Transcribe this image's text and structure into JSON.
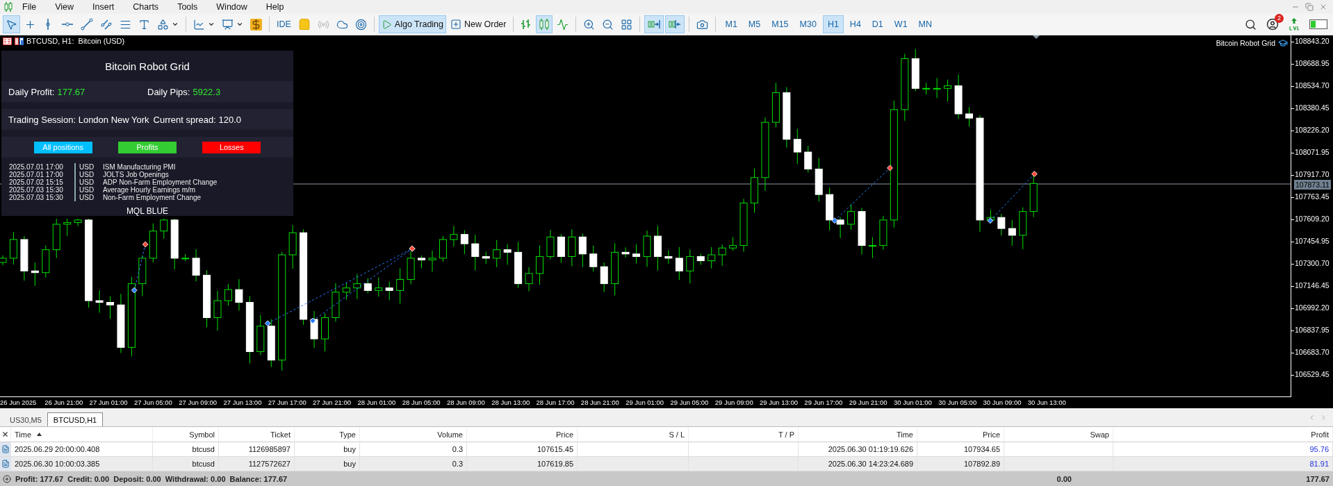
{
  "menu": [
    "File",
    "View",
    "Insert",
    "Charts",
    "Tools",
    "Window",
    "Help"
  ],
  "toolbar": [
    {
      "kind": "cursor",
      "selected": true
    },
    {
      "kind": "crosshair",
      "selected": false
    },
    {
      "kind": "vline",
      "selected": false
    },
    {
      "kind": "hline",
      "selected": false
    },
    {
      "kind": "trendline",
      "selected": false
    },
    {
      "kind": "channel",
      "selected": false
    },
    {
      "kind": "fibo",
      "selected": false
    },
    {
      "kind": "text",
      "selected": false
    },
    {
      "kind": "shapes",
      "selected": false
    },
    {
      "kind": "indicators",
      "selected": false
    },
    {
      "kind": "templates",
      "selected": false
    },
    {
      "kind": "dollar",
      "selected": false
    },
    {
      "kind": "ide",
      "label": "IDE",
      "selected": false
    },
    {
      "kind": "market",
      "selected": false
    },
    {
      "kind": "signals",
      "selected": false
    },
    {
      "kind": "cloud",
      "selected": false
    },
    {
      "kind": "vps",
      "selected": false
    },
    {
      "kind": "algo",
      "label": "Algo Trading",
      "selected": true
    },
    {
      "kind": "order",
      "label": "New Order",
      "selected": false
    },
    {
      "kind": "bars",
      "selected": false
    },
    {
      "kind": "candles",
      "selected": true
    },
    {
      "kind": "line",
      "selected": false
    },
    {
      "kind": "zoomin",
      "selected": false
    },
    {
      "kind": "zoomout",
      "selected": false
    },
    {
      "kind": "tile",
      "selected": false
    },
    {
      "kind": "autoscroll",
      "selected": true
    },
    {
      "kind": "shift",
      "selected": true
    },
    {
      "kind": "screenshot",
      "selected": false
    }
  ],
  "timeframes": [
    {
      "label": "M1",
      "selected": false
    },
    {
      "label": "M5",
      "selected": false
    },
    {
      "label": "M15",
      "selected": false
    },
    {
      "label": "M30",
      "selected": false
    },
    {
      "label": "H1",
      "selected": true
    },
    {
      "label": "H4",
      "selected": false
    },
    {
      "label": "D1",
      "selected": false
    },
    {
      "label": "W1",
      "selected": false
    },
    {
      "label": "MN",
      "selected": false
    }
  ],
  "notifications": {
    "count": "2"
  },
  "chart": {
    "title": "BTCUSD, H1:  Bitcoin (USD)",
    "indicator": "Bitcoin Robot Grid",
    "current_price": "107873.11",
    "price_ticks": [
      "108843.20",
      "108688.95",
      "108534.70",
      "108380.45",
      "108226.20",
      "108071.95",
      "107917.70",
      "107763.45",
      "107609.20",
      "107454.95",
      "107300.70",
      "107146.45",
      "106992.20",
      "106837.95",
      "106683.70",
      "106529.45"
    ],
    "time_ticks": [
      "26 Jun 2025",
      "26 Jun 21:00",
      "27 Jun 01:00",
      "27 Jun 05:00",
      "27 Jun 09:00",
      "27 Jun 13:00",
      "27 Jun 17:00",
      "27 Jun 21:00",
      "28 Jun 01:00",
      "28 Jun 05:00",
      "28 Jun 09:00",
      "28 Jun 13:00",
      "28 Jun 17:00",
      "28 Jun 21:00",
      "29 Jun 01:00",
      "29 Jun 05:00",
      "29 Jun 09:00",
      "29 Jun 13:00",
      "29 Jun 17:00",
      "29 Jun 21:00",
      "30 Jun 01:00",
      "30 Jun 05:00",
      "30 Jun 09:00",
      "30 Jun 13:00"
    ],
    "panel": {
      "title": "Bitcoin Robot Grid",
      "daily_profit_label": "Daily Profit:",
      "daily_profit": "177.67",
      "daily_pips_label": "Daily Pips:",
      "daily_pips": "5922.3",
      "session": "Trading Session: London New York",
      "spread": "Current spread: 120.0",
      "buttons": [
        {
          "label": "All positions",
          "color": "#00bfff"
        },
        {
          "label": "Profits",
          "color": "#33cc33"
        },
        {
          "label": "Losses",
          "color": "#ff0000"
        }
      ],
      "news": [
        {
          "time": "2025.07.01 17:00",
          "currency": "USD",
          "event": "ISM Manufacturing PMI"
        },
        {
          "time": "2025.07.01 17:00",
          "currency": "USD",
          "event": "JOLTS Job Openings"
        },
        {
          "time": "2025.07.02 15:15",
          "currency": "USD",
          "event": "ADP Non-Farm Employment Change"
        },
        {
          "time": "2025.07.03 15:30",
          "currency": "USD",
          "event": "Average Hourly Earnings m/m"
        },
        {
          "time": "2025.07.03 15:30",
          "currency": "USD",
          "event": "Non-Farm Employment Change"
        }
      ],
      "footer": "MQL BLUE"
    }
  },
  "tabs": [
    {
      "label": "US30,M5",
      "selected": false
    },
    {
      "label": "BTCUSD,H1",
      "selected": true
    }
  ],
  "positions": {
    "columns": [
      {
        "label": "Time",
        "sorted": true
      },
      {
        "label": "Symbol",
        "sorted": false
      },
      {
        "label": "Ticket",
        "sorted": false
      },
      {
        "label": "Type",
        "sorted": false
      },
      {
        "label": "Volume",
        "sorted": false
      },
      {
        "label": "Price",
        "sorted": false
      },
      {
        "label": "S / L",
        "sorted": false
      },
      {
        "label": "T / P",
        "sorted": false
      },
      {
        "label": "Time",
        "sorted": false
      },
      {
        "label": "Price",
        "sorted": false
      },
      {
        "label": "Swap",
        "sorted": false
      },
      {
        "label": "Profit",
        "sorted": false
      }
    ],
    "rows": [
      [
        "2025.06.29 20:00:00.408",
        "btcusd",
        "1126985897",
        "buy",
        "0.3",
        "107615.45",
        "",
        "",
        "2025.06.30 01:19:19.626",
        "107934.65",
        "",
        "95.76"
      ],
      [
        "2025.06.30 10:00:03.385",
        "btcusd",
        "1127572627",
        "buy",
        "0.3",
        "107619.85",
        "",
        "",
        "2025.06.30 14:23:24.689",
        "107892.89",
        "",
        "81.91"
      ]
    ],
    "summary": {
      "text": "Profit: 177.67  Credit: 0.00  Deposit: 0.00  Withdrawal: 0.00  Balance: 177.67",
      "swap": "0.00",
      "profit": "177.67"
    }
  }
}
